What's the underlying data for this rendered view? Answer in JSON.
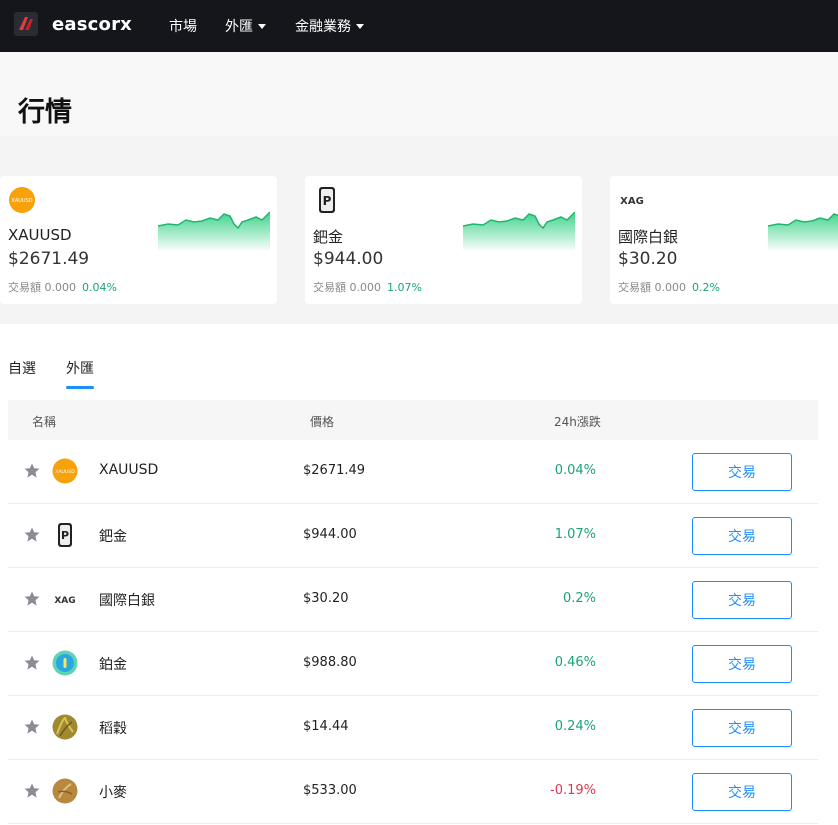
{
  "header": {
    "brand": "eascorx",
    "nav": [
      "市場",
      "外匯",
      "金融業務"
    ]
  },
  "page_title": "行情",
  "cards": [
    {
      "icon": "xauusd-coin-icon",
      "icon_text": "XAUUSD",
      "name": "XAUUSD",
      "price": "$2671.49",
      "volume_label": "交易額 0.000",
      "change": "0.04%"
    },
    {
      "icon": "palladium-bar-icon",
      "icon_text": "",
      "name": "鈀金",
      "price": "$944.00",
      "volume_label": "交易額 0.000",
      "change": "1.07%"
    },
    {
      "icon": "xag-text-icon",
      "icon_text": "XAG",
      "name": "國際白銀",
      "price": "$30.20",
      "volume_label": "交易額 0.000",
      "change": "0.2%"
    }
  ],
  "tabs": [
    "自選",
    "外匯"
  ],
  "active_tab": "外匯",
  "table": {
    "headers": [
      "名稱",
      "價格",
      "24h漲跌"
    ],
    "trade_label": "交易",
    "rows": [
      {
        "icon": "xauusd-coin-icon",
        "icon_text": "XAUUSD",
        "name": "XAUUSD",
        "price": "$2671.49",
        "change": "0.04%",
        "dir": "pos"
      },
      {
        "icon": "palladium-bar-icon",
        "icon_text": "",
        "name": "鈀金",
        "price": "$944.00",
        "change": "1.07%",
        "dir": "pos"
      },
      {
        "icon": "xag-text-icon",
        "icon_text": "XAG",
        "name": "國際白銀",
        "price": "$30.20",
        "change": "0.2%",
        "dir": "pos"
      },
      {
        "icon": "platinum-coin-icon",
        "icon_text": "",
        "name": "鉑金",
        "price": "$988.80",
        "change": "0.46%",
        "dir": "pos"
      },
      {
        "icon": "rice-photo-icon",
        "icon_text": "",
        "name": "稻穀",
        "price": "$14.44",
        "change": "0.24%",
        "dir": "pos"
      },
      {
        "icon": "wheat-photo-icon",
        "icon_text": "",
        "name": "小麥",
        "price": "$533.00",
        "change": "-0.19%",
        "dir": "neg"
      }
    ]
  },
  "colors": {
    "header_bg": "#14161b",
    "accent": "#1890ff",
    "up": "#1aa37a",
    "down": "#e0364f",
    "spark_fill": "#3fd38a"
  }
}
